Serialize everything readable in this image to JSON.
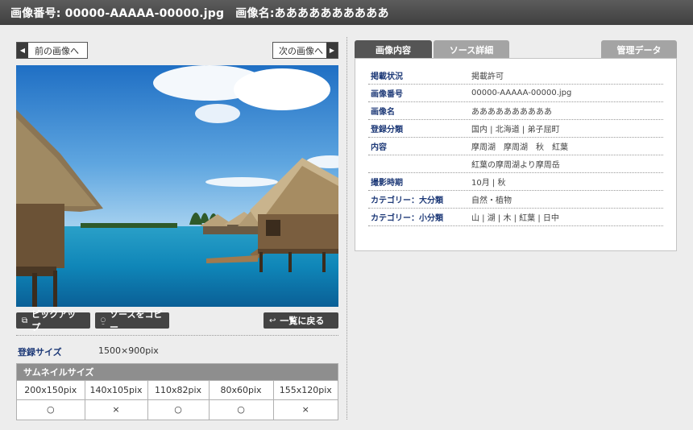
{
  "header": {
    "image_number": "画像番号:  00000-AAAAA-00000.jpg",
    "image_name": "画像名:ああああああああああ"
  },
  "nav": {
    "prev_label": "前の画像へ",
    "next_label": "次の画像へ"
  },
  "actions": {
    "pickup_label": "ピックアップ",
    "copy_label": "ソースをコピー",
    "back_label": "一覧に戻る"
  },
  "registered_size": {
    "label": "登録サイズ",
    "value": "1500×900pix"
  },
  "thumbnails": {
    "title": "サムネイルサイズ",
    "sizes": [
      "200x150pix",
      "140x105pix",
      "110x82pix",
      "80x60pix",
      "155x120pix"
    ],
    "availability": [
      "○",
      "×",
      "○",
      "○",
      "×"
    ]
  },
  "tabs": [
    "画像内容",
    "ソース詳細",
    "管理データ"
  ],
  "details": [
    {
      "label": "掲載状況",
      "value": "掲載許可"
    },
    {
      "label": "画像番号",
      "value": "00000-AAAAA-00000.jpg"
    },
    {
      "label": "画像名",
      "value": "ああああああああああ"
    },
    {
      "label": "登録分類",
      "value": "国内 | 北海道 | 弟子屈町"
    },
    {
      "label": "内容",
      "value": "摩周湖　摩周湖　秋　紅葉"
    },
    {
      "label": "",
      "value": "紅葉の摩周湖より摩周岳"
    },
    {
      "label": "撮影時期",
      "value": "10月 | 秋"
    },
    {
      "label": "カテゴリー：大分類",
      "value": "自然・植物"
    },
    {
      "label": "カテゴリー：小分類",
      "value": "山 | 湖 | 木 | 紅葉 | 日中"
    }
  ],
  "colors": {
    "accent_label": "#1e3a78",
    "header_bg": "#4a4a4a",
    "active_tab": "#555555",
    "inactive_tab": "#a4a4a4"
  }
}
